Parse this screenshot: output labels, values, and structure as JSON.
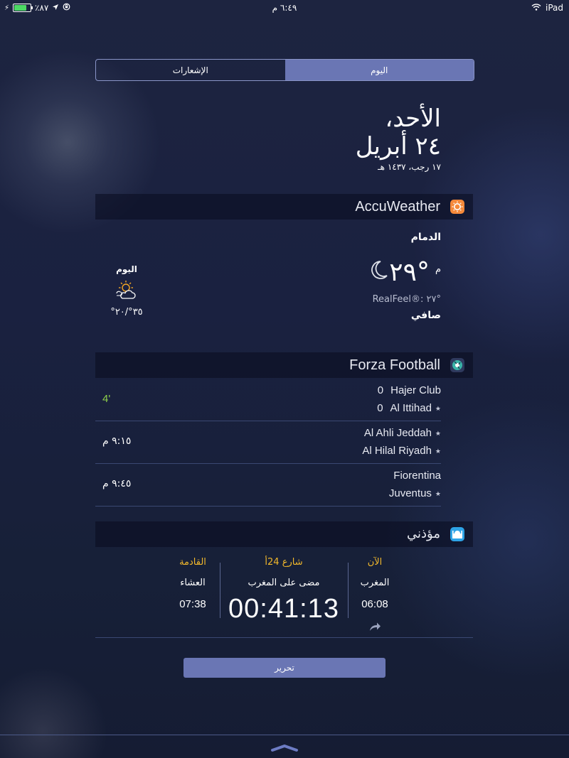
{
  "status_bar": {
    "battery_percent": "٪٨٧",
    "time": "٦:٤٩ م",
    "device": "iPad",
    "battery_level": 0.87
  },
  "segment": {
    "today": "اليوم",
    "notifications": "الإشعارات"
  },
  "date": {
    "day": "الأحد،",
    "date": "٢٤ أبريل",
    "hijri": "١٧ رجب، ١٤٣٧ هـ"
  },
  "weather": {
    "app_name": "AccuWeather",
    "city": "الدمام",
    "temperature": "٢٩°",
    "unit": "م",
    "realfeel": "RealFeel®: ٢٧°",
    "condition": "صافي",
    "forecast_label": "اليوم",
    "hi_lo": "٣٥°/٢٠°",
    "icons": {
      "current": "moon-icon",
      "forecast": "sun-cloud-icon"
    },
    "colors": {
      "icon_bg": "#f5893a"
    }
  },
  "football": {
    "app_name": "Forza Football",
    "matches": [
      {
        "home": "Hajer Club",
        "home_score": "0",
        "away": "Al Ittihad",
        "away_score": "0",
        "status": "4'"
      },
      {
        "home": "Al Ahli Jeddah",
        "home_score": "",
        "away": "Al Hilal Riyadh",
        "away_score": "",
        "status": "٩:١٥ م"
      },
      {
        "home": "Fiorentina",
        "home_score": "",
        "away": "Juventus",
        "away_score": "",
        "status": "٩:٤٥ م"
      }
    ],
    "colors": {
      "live": "#8ed04a"
    }
  },
  "prayer": {
    "app_name": "مؤذني",
    "next": {
      "label": "القادمة",
      "name": "العشاء",
      "time": "07:38"
    },
    "middle": {
      "label": "شارع 24أ",
      "name": "مضى على المغرب",
      "time": "00:41:13"
    },
    "now": {
      "label": "الآن",
      "name": "المغرب",
      "time": "06:08"
    },
    "colors": {
      "label": "#f2b82b"
    }
  },
  "edit_button": "تحرير"
}
